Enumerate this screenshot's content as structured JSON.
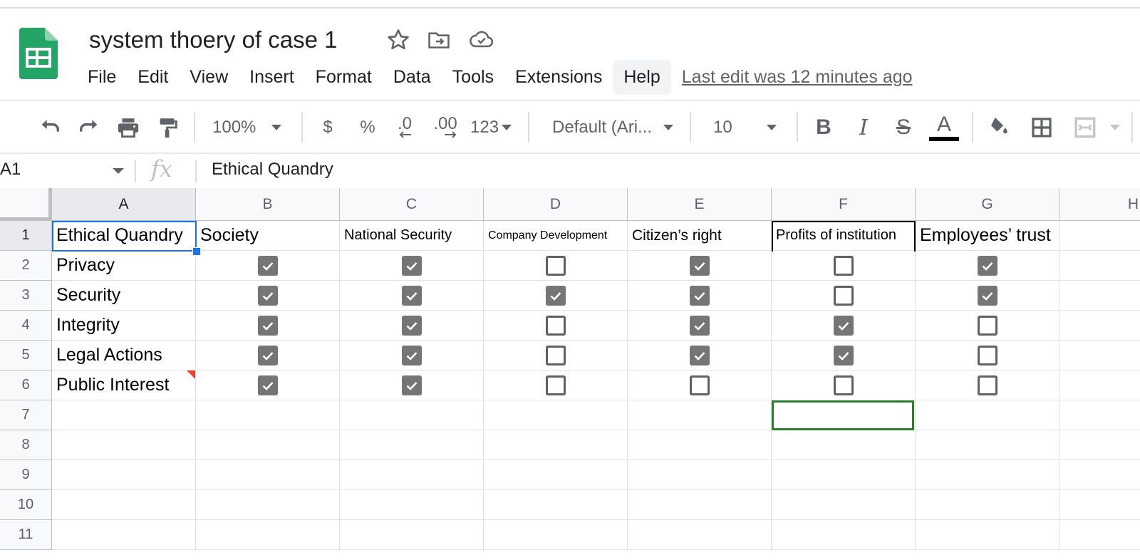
{
  "doc": {
    "title": "system thoery of case 1",
    "last_edit": "Last edit was 12 minutes ago"
  },
  "menu": [
    "File",
    "Edit",
    "View",
    "Insert",
    "Format",
    "Data",
    "Tools",
    "Extensions",
    "Help"
  ],
  "toolbar": {
    "zoom": "100%",
    "currency": "$",
    "percent": "%",
    "dec_decrease": ".0",
    "dec_increase": ".00",
    "number_format": "123",
    "font": "Default (Ari...",
    "font_size": "10",
    "bold": "B",
    "italic": "I",
    "strike": "S",
    "text_color": "A",
    "text_color_value": "#000000"
  },
  "formula_bar": {
    "name_box": "A1",
    "fx": "fx",
    "value": "Ethical Quandry"
  },
  "sheet": {
    "columns": [
      "A",
      "B",
      "C",
      "D",
      "E",
      "F",
      "G",
      "H"
    ],
    "rows": [
      "1",
      "2",
      "3",
      "4",
      "5",
      "6",
      "7",
      "8",
      "9",
      "10",
      "11"
    ],
    "headers": [
      "Ethical Quandry",
      "Society",
      "National Security",
      "Company Development",
      "Citizen’s right",
      "Profits of institution",
      "Employees’ trust"
    ],
    "data": [
      {
        "label": "Privacy",
        "checks": [
          true,
          true,
          false,
          true,
          false,
          true
        ]
      },
      {
        "label": "Security",
        "checks": [
          true,
          true,
          true,
          true,
          false,
          true
        ]
      },
      {
        "label": "Integrity",
        "checks": [
          true,
          true,
          false,
          true,
          true,
          false
        ]
      },
      {
        "label": "Legal Actions",
        "checks": [
          true,
          true,
          false,
          true,
          true,
          false
        ]
      },
      {
        "label": "Public Interest",
        "checks": [
          true,
          true,
          false,
          false,
          false,
          false
        ]
      }
    ],
    "active_cell": "A1",
    "highlighted_cell": "F7",
    "note_cell": "A6"
  },
  "colors": {
    "sheets_green": "#23a566",
    "selection_blue": "#1a73e8",
    "checkbox_checked": "#757575",
    "note_red": "#ea4335"
  }
}
